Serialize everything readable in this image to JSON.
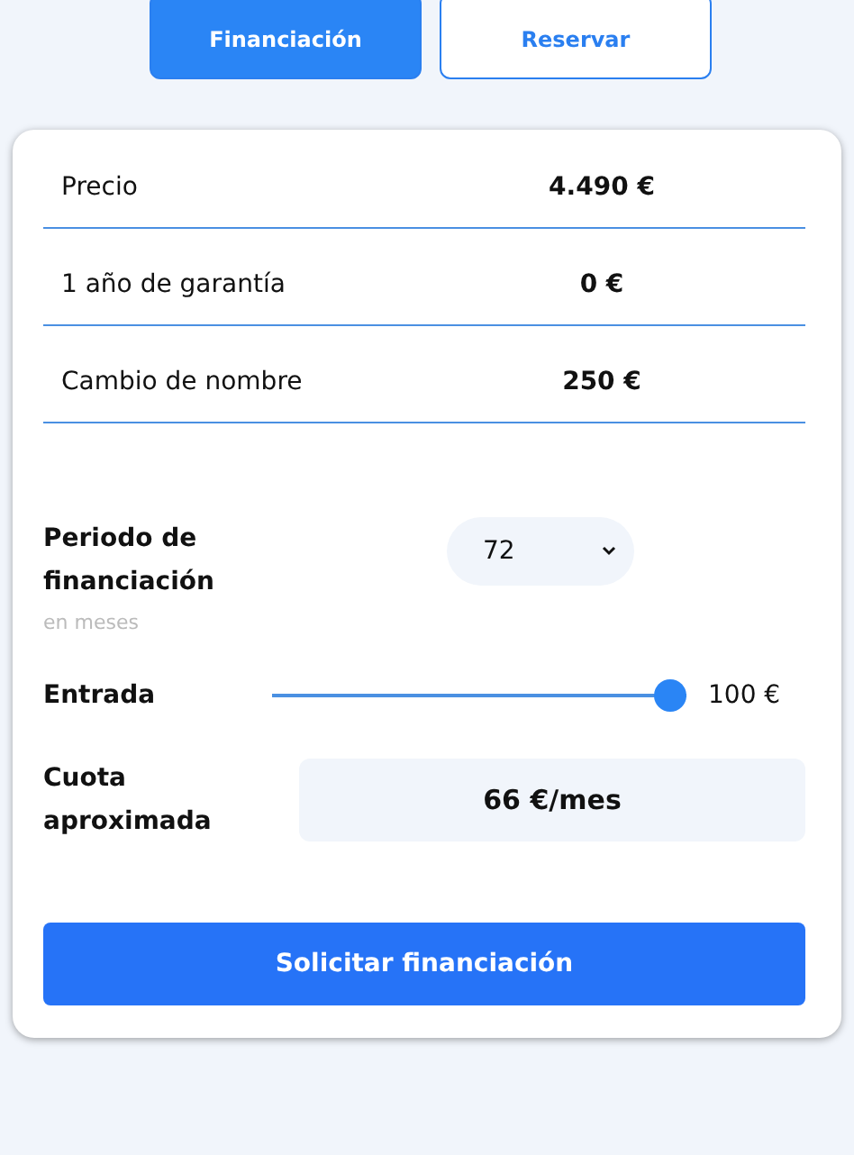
{
  "tabs": [
    {
      "label": "Financiación",
      "selected": true
    },
    {
      "label": "Reservar",
      "selected": false
    }
  ],
  "costs": [
    {
      "label": "Precio",
      "value": "4.490 €"
    },
    {
      "label": "1 año de garantía",
      "value": "0 €"
    },
    {
      "label": "Cambio de nombre",
      "value": "250 €"
    }
  ],
  "period": {
    "label": "Periodo de financiación",
    "hint": "en meses",
    "value": "72"
  },
  "down_payment": {
    "label": "Entrada",
    "level": 1,
    "reading": "100 €"
  },
  "installment": {
    "label": "Cuota aproximada",
    "value": "66 €/mes"
  },
  "submit": "Solicitar financiación"
}
